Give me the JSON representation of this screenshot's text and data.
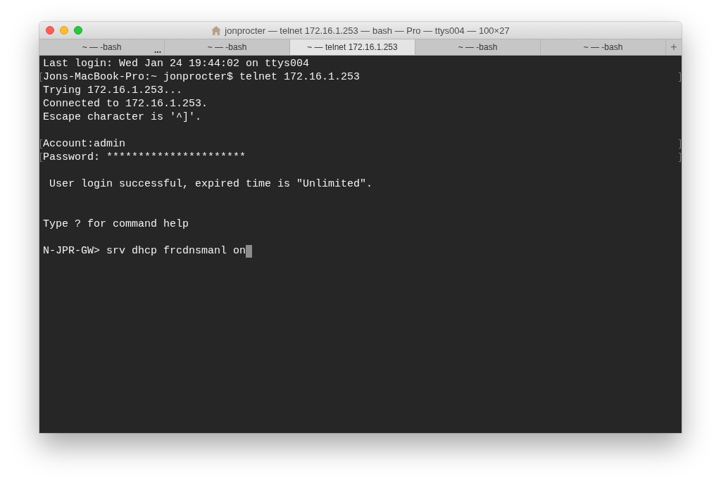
{
  "window": {
    "title": "jonprocter — telnet 172.16.1.253 — bash — Pro — ttys004 — 100×27"
  },
  "tabs": [
    {
      "label": "~ — -bash",
      "selected": false,
      "badge": "..."
    },
    {
      "label": "~ — -bash",
      "selected": false
    },
    {
      "label": "~ — telnet 172.16.1.253",
      "selected": true
    },
    {
      "label": "~ — -bash",
      "selected": false
    },
    {
      "label": "~ — -bash",
      "selected": false
    }
  ],
  "new_tab_button": "+",
  "terminal": {
    "lines": [
      {
        "kind": "text",
        "text": "Last login: Wed Jan 24 19:44:02 on ttys004",
        "marked": false
      },
      {
        "kind": "text",
        "text": "Jons-MacBook-Pro:~ jonprocter$ telnet 172.16.1.253",
        "marked": true
      },
      {
        "kind": "text",
        "text": "Trying 172.16.1.253...",
        "marked": false
      },
      {
        "kind": "text",
        "text": "Connected to 172.16.1.253.",
        "marked": false
      },
      {
        "kind": "text",
        "text": "Escape character is '^]'.",
        "marked": false
      },
      {
        "kind": "blank"
      },
      {
        "kind": "text",
        "text": "Account:admin",
        "marked": true
      },
      {
        "kind": "text",
        "text": "Password: **********************",
        "marked": true
      },
      {
        "kind": "blank"
      },
      {
        "kind": "text",
        "text": " User login successful, expired time is \"Unlimited\".",
        "marked": false
      },
      {
        "kind": "blank"
      },
      {
        "kind": "blank"
      },
      {
        "kind": "text",
        "text": "Type ? for command help",
        "marked": false
      },
      {
        "kind": "blank"
      },
      {
        "kind": "prompt",
        "text": "N-JPR-GW> srv dhcp frcdnsmanl on",
        "marked": false,
        "cursor": true
      }
    ]
  }
}
